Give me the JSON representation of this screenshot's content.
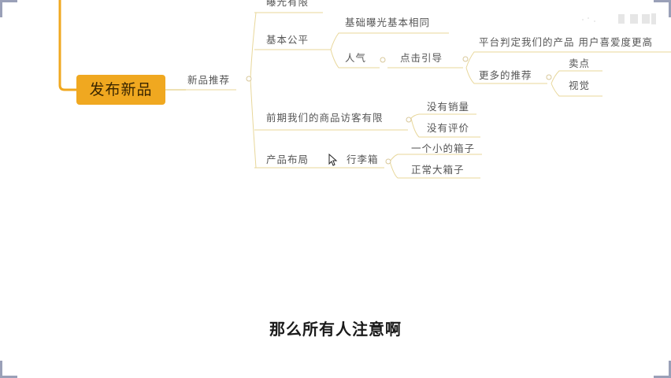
{
  "mindmap": {
    "root": "发布新品",
    "branch": "新品推荐",
    "nodes": {
      "exposure_limited": "曝光有限",
      "basic_fair": "基本公平",
      "basic_exposure_same": "基础曝光基本相同",
      "popularity": "人气",
      "click_guide": "点击引导",
      "platform_judge": "平台判定我们的产品 用户喜爱度更高",
      "more_recommend": "更多的推荐",
      "selling_point": "卖点",
      "visual": "视觉",
      "early_visitors": "前期我们的商品访客有限",
      "no_sales": "没有销量",
      "no_reviews": "没有评价",
      "product_layout": "产品布局",
      "trunk_box": "行李箱",
      "small_box": "一个小的箱子",
      "normal_box": "正常大箱子"
    }
  },
  "subtitle": "那么所有人注意啊",
  "colors": {
    "root_fill": "#f0a820",
    "trunk_line": "#f0a820",
    "branch_line": "#e8d79a",
    "corner_marks": "#9aa0b8"
  },
  "icons": {
    "cursor": "mouse-pointer-icon"
  }
}
